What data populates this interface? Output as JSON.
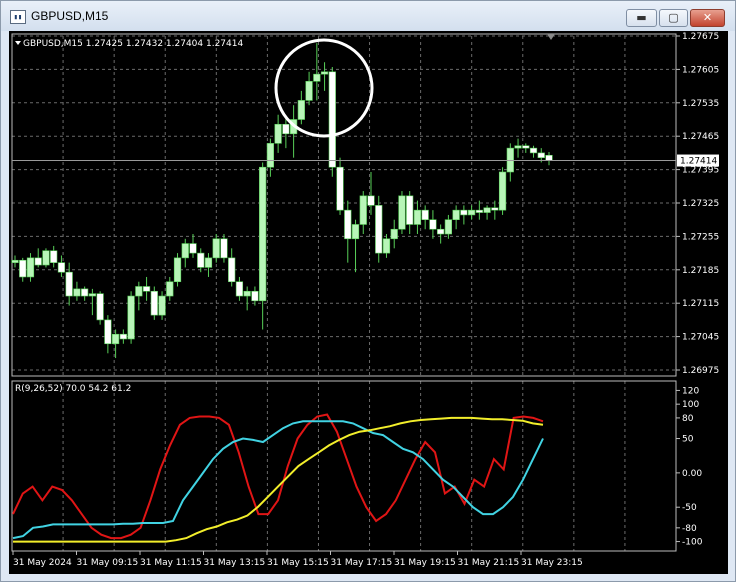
{
  "window": {
    "title": "GBPUSD,M15",
    "icon": "chart-window-icon",
    "buttons": {
      "minimize": "▬",
      "maximize": "▢",
      "close": "✕"
    }
  },
  "colors": {
    "background": "#000000",
    "grid": "#6b6b6b",
    "bull_candle": "#b8f5b8",
    "bear_candle": "#ffffff",
    "wick": "#58d058",
    "rsi_fast": "#e01515",
    "rsi_mid": "#41d3e3",
    "rsi_slow": "#f2ee2b",
    "text": "#ffffff"
  },
  "chart_data": [
    {
      "type": "candlestick",
      "header": "GBPUSD,M15  1.27425 1.27432 1.27404 1.27414",
      "price_ticks": [
        "1.27675",
        "1.27605",
        "1.27535",
        "1.27465",
        "1.27395",
        "1.27325",
        "1.27255",
        "1.27185",
        "1.27115",
        "1.27045",
        "1.26975"
      ],
      "ylim": [
        1.26975,
        1.27675
      ],
      "current_price": "1.27414",
      "x_labels": [
        "31 May 2024",
        "31 May 09:15",
        "31 May 11:15",
        "31 May 13:15",
        "31 May 15:15",
        "31 May 17:15",
        "31 May 19:15",
        "31 May 21:15",
        "31 May 23:15"
      ],
      "annotation": "circle around session high",
      "candles": [
        [
          1.272,
          1.27215,
          1.2719,
          1.27205
        ],
        [
          1.27205,
          1.2721,
          1.2716,
          1.2717
        ],
        [
          1.2717,
          1.2722,
          1.2716,
          1.2721
        ],
        [
          1.2721,
          1.2723,
          1.2719,
          1.27195
        ],
        [
          1.27195,
          1.2723,
          1.2719,
          1.27225
        ],
        [
          1.27225,
          1.27235,
          1.2719,
          1.272
        ],
        [
          1.272,
          1.27215,
          1.2717,
          1.2718
        ],
        [
          1.2718,
          1.272,
          1.2711,
          1.2713
        ],
        [
          1.2713,
          1.2716,
          1.2712,
          1.27145
        ],
        [
          1.27145,
          1.2715,
          1.2712,
          1.2713
        ],
        [
          1.2713,
          1.27145,
          1.2709,
          1.27135
        ],
        [
          1.27135,
          1.2714,
          1.2707,
          1.2708
        ],
        [
          1.2708,
          1.2709,
          1.2701,
          1.2703
        ],
        [
          1.2703,
          1.2706,
          1.27,
          1.2705
        ],
        [
          1.2705,
          1.2706,
          1.2703,
          1.2704
        ],
        [
          1.2704,
          1.2714,
          1.2703,
          1.2713
        ],
        [
          1.2713,
          1.2716,
          1.271,
          1.2715
        ],
        [
          1.2715,
          1.2717,
          1.2712,
          1.2714
        ],
        [
          1.2714,
          1.2715,
          1.2708,
          1.2709
        ],
        [
          1.2709,
          1.2714,
          1.2708,
          1.2713
        ],
        [
          1.2713,
          1.2717,
          1.2712,
          1.2716
        ],
        [
          1.2716,
          1.2722,
          1.2715,
          1.2721
        ],
        [
          1.2721,
          1.2725,
          1.2719,
          1.2724
        ],
        [
          1.2724,
          1.2726,
          1.2721,
          1.2722
        ],
        [
          1.2722,
          1.2723,
          1.2718,
          1.2719
        ],
        [
          1.2719,
          1.2722,
          1.2717,
          1.2721
        ],
        [
          1.2721,
          1.2726,
          1.272,
          1.2725
        ],
        [
          1.2725,
          1.2726,
          1.272,
          1.2721
        ],
        [
          1.2721,
          1.2723,
          1.2715,
          1.2716
        ],
        [
          1.2716,
          1.2717,
          1.2712,
          1.2713
        ],
        [
          1.2713,
          1.2715,
          1.271,
          1.2714
        ],
        [
          1.2714,
          1.2715,
          1.2711,
          1.2712
        ],
        [
          1.2712,
          1.2741,
          1.2706,
          1.274
        ],
        [
          1.274,
          1.2746,
          1.2738,
          1.2745
        ],
        [
          1.2745,
          1.2751,
          1.2743,
          1.2749
        ],
        [
          1.2749,
          1.275,
          1.2744,
          1.2747
        ],
        [
          1.2747,
          1.2753,
          1.2742,
          1.275
        ],
        [
          1.275,
          1.2756,
          1.2749,
          1.2754
        ],
        [
          1.2754,
          1.276,
          1.2753,
          1.2758
        ],
        [
          1.2758,
          1.2766,
          1.2754,
          1.27595
        ],
        [
          1.27595,
          1.2762,
          1.2756,
          1.276
        ],
        [
          1.276,
          1.2761,
          1.2738,
          1.274
        ],
        [
          1.274,
          1.2742,
          1.273,
          1.2731
        ],
        [
          1.2731,
          1.2733,
          1.272,
          1.2725
        ],
        [
          1.2725,
          1.2729,
          1.2718,
          1.2728
        ],
        [
          1.2728,
          1.2735,
          1.2726,
          1.2734
        ],
        [
          1.2734,
          1.2739,
          1.273,
          1.2732
        ],
        [
          1.2732,
          1.2734,
          1.272,
          1.2722
        ],
        [
          1.2722,
          1.2726,
          1.2721,
          1.2725
        ],
        [
          1.2725,
          1.2729,
          1.2723,
          1.2727
        ],
        [
          1.2727,
          1.2735,
          1.2726,
          1.2734
        ],
        [
          1.2734,
          1.2735,
          1.2726,
          1.2728
        ],
        [
          1.2728,
          1.2733,
          1.2726,
          1.2731
        ],
        [
          1.2731,
          1.2732,
          1.2727,
          1.2729
        ],
        [
          1.2729,
          1.2731,
          1.2725,
          1.2727
        ],
        [
          1.2727,
          1.2728,
          1.2724,
          1.2726
        ],
        [
          1.2726,
          1.273,
          1.2725,
          1.2729
        ],
        [
          1.2729,
          1.2732,
          1.2727,
          1.2731
        ],
        [
          1.2731,
          1.2732,
          1.2728,
          1.273
        ],
        [
          1.273,
          1.2732,
          1.2729,
          1.2731
        ],
        [
          1.2731,
          1.2733,
          1.2729,
          1.27305
        ],
        [
          1.27305,
          1.2732,
          1.2729,
          1.27315
        ],
        [
          1.27315,
          1.2733,
          1.2729,
          1.2731
        ],
        [
          1.2731,
          1.274,
          1.273,
          1.2739
        ],
        [
          1.2739,
          1.2745,
          1.2737,
          1.2744
        ],
        [
          1.2744,
          1.2746,
          1.2742,
          1.27445
        ],
        [
          1.27445,
          1.2745,
          1.2743,
          1.2744
        ],
        [
          1.2744,
          1.27445,
          1.2742,
          1.2743
        ],
        [
          1.2743,
          1.2744,
          1.2741,
          1.2742
        ],
        [
          1.27425,
          1.27432,
          1.27404,
          1.27414
        ]
      ]
    },
    {
      "type": "line",
      "header": "R(9,26,52) 70.0 54.2 61.2",
      "ylim": [
        -105,
        125
      ],
      "y_ticks": [
        "120",
        "100",
        "80",
        "50",
        "0.00",
        "-50",
        "-80",
        "-100"
      ],
      "series": [
        {
          "values": [
            -60,
            -30,
            -20,
            -40,
            -20,
            -25,
            -40,
            -60,
            -80,
            -90,
            -95,
            -95,
            -90,
            -80,
            -40,
            5,
            40,
            70,
            80,
            82,
            82,
            80,
            70,
            30,
            -20,
            -60,
            -60,
            -40,
            10,
            50,
            70,
            82,
            85,
            60,
            20,
            -20,
            -50,
            -70,
            -60,
            -40,
            -10,
            20,
            45,
            30,
            -30,
            -20,
            -45,
            -10,
            -20,
            20,
            5,
            80,
            82,
            80,
            75
          ]
        },
        {
          "values": [
            -95,
            -92,
            -80,
            -78,
            -75,
            -75,
            -75,
            -75,
            -75,
            -75,
            -75,
            -74,
            -74,
            -73,
            -73,
            -73,
            -70,
            -40,
            -20,
            0,
            20,
            35,
            45,
            50,
            48,
            45,
            55,
            65,
            72,
            75,
            75,
            75,
            75,
            75,
            72,
            65,
            58,
            55,
            45,
            35,
            30,
            20,
            5,
            -10,
            -20,
            -35,
            -50,
            -60,
            -60,
            -50,
            -35,
            -10,
            20,
            50
          ]
        },
        {
          "values": [
            -100,
            -100,
            -100,
            -100,
            -100,
            -100,
            -100,
            -100,
            -100,
            -100,
            -100,
            -100,
            -100,
            -100,
            -100,
            -100,
            -98,
            -95,
            -88,
            -82,
            -78,
            -72,
            -68,
            -62,
            -50,
            -35,
            -20,
            -5,
            10,
            20,
            30,
            40,
            48,
            55,
            60,
            62,
            65,
            68,
            72,
            75,
            77,
            78,
            79,
            80,
            80,
            80,
            79,
            78,
            78,
            77,
            76,
            72,
            70
          ]
        }
      ]
    }
  ]
}
